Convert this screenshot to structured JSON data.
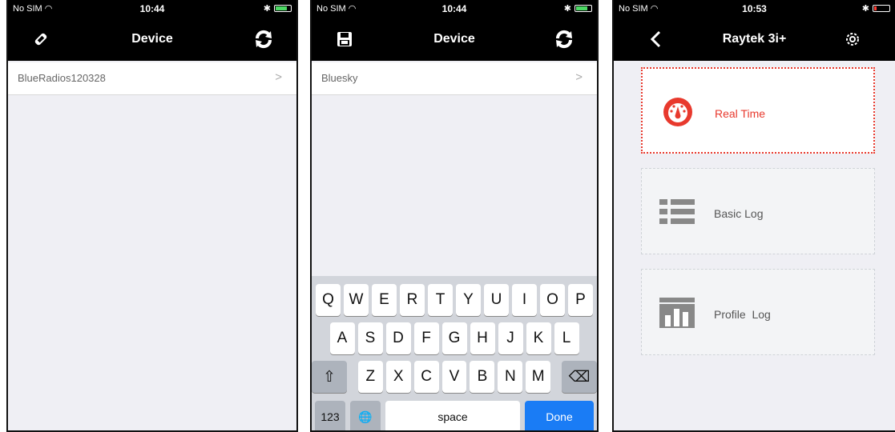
{
  "screen1": {
    "status": {
      "carrier": "No SIM",
      "time": "10:44"
    },
    "nav_title": "Device",
    "left_icon": "wrench-icon",
    "right_icon": "refresh-icon",
    "device_row": {
      "label": "BlueRadios120328",
      "chevron": ">"
    }
  },
  "screen2": {
    "status": {
      "carrier": "No SIM",
      "time": "10:44"
    },
    "nav_title": "Device",
    "left_icon": "save-icon",
    "right_icon": "refresh-icon",
    "device_row": {
      "label": "Bluesky",
      "chevron": ">"
    },
    "keyboard": {
      "row1": [
        "Q",
        "W",
        "E",
        "R",
        "T",
        "Y",
        "U",
        "I",
        "O",
        "P"
      ],
      "row2": [
        "A",
        "S",
        "D",
        "F",
        "G",
        "H",
        "J",
        "K",
        "L"
      ],
      "row3": [
        "Z",
        "X",
        "C",
        "V",
        "B",
        "N",
        "M"
      ],
      "num_key": "123",
      "space_key": "space",
      "done_key": "Done"
    }
  },
  "screen3": {
    "status": {
      "carrier": "No SIM",
      "time": "10:53"
    },
    "nav_title": "Raytek 3i+",
    "left_icon": "back-icon",
    "right_icon": "gear-icon",
    "cards": [
      {
        "label": "Real Time",
        "icon": "gauge-icon",
        "active": true
      },
      {
        "label": "Basic Log",
        "icon": "list-icon",
        "active": false
      },
      {
        "label": "Profile  Log",
        "icon": "bar-chart-icon",
        "active": false
      }
    ]
  },
  "colors": {
    "accent_red": "#e8392d",
    "done_blue": "#1a7cf5",
    "battery_green": "#4cd964"
  }
}
